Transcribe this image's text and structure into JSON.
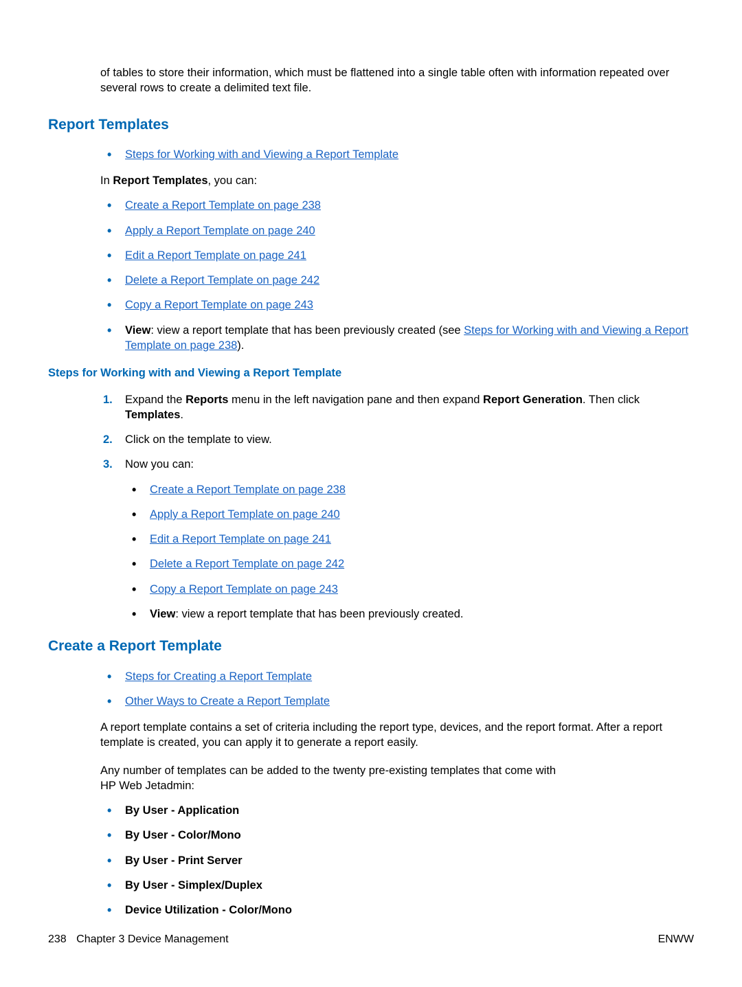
{
  "intro_paragraph": "of tables to store their information, which must be flattened into a single table often with information repeated over several rows to create a delimited text file.",
  "section1": {
    "title": "Report Templates",
    "top_link": "Steps for Working with and Viewing a Report Template",
    "intro_pre": "In ",
    "intro_bold": "Report Templates",
    "intro_post": ", you can:",
    "items": {
      "create": "Create a Report Template on page 238",
      "apply": "Apply a Report Template on page 240",
      "edit": "Edit a Report Template on page 241",
      "delete": "Delete a Report Template on page 242",
      "copy": "Copy a Report Template on page 243",
      "view_label": "View",
      "view_text": ": view a report template that has been previously created (see ",
      "view_link": "Steps for Working with and Viewing a Report Template on page 238",
      "view_close": ")."
    }
  },
  "subsection": {
    "title": "Steps for Working with and Viewing a Report Template",
    "steps": {
      "s1_pre": "Expand the ",
      "s1_b1": "Reports",
      "s1_mid": " menu in the left navigation pane and then expand ",
      "s1_b2": "Report Generation",
      "s1_post": ". Then click ",
      "s1_b3": "Templates",
      "s1_end": ".",
      "s2": "Click on the template to view.",
      "s3": "Now you can:"
    },
    "nested": {
      "create": "Create a Report Template on page 238",
      "apply": "Apply a Report Template on page 240",
      "edit": "Edit a Report Template on page 241",
      "delete": "Delete a Report Template on page 242",
      "copy": "Copy a Report Template on page 243",
      "view_label": "View",
      "view_text": ": view a report template that has been previously created."
    }
  },
  "section2": {
    "title": "Create a Report Template",
    "top_links": {
      "l1": "Steps for Creating a Report Template",
      "l2": "Other Ways to Create a Report Template"
    },
    "para1": "A report template contains a set of criteria including the report type, devices, and the report format. After a report template is created, you can apply it to generate a report easily.",
    "para2a": "Any number of templates can be added to the twenty pre-existing templates that come with",
    "para2b": "HP Web Jetadmin:",
    "bold_items": {
      "i1": "By User - Application",
      "i2": "By User - Color/Mono",
      "i3": "By User - Print Server",
      "i4": "By User - Simplex/Duplex",
      "i5": "Device Utilization - Color/Mono"
    }
  },
  "footer": {
    "page_number": "238",
    "chapter": "Chapter 3   Device Management",
    "right": "ENWW"
  }
}
